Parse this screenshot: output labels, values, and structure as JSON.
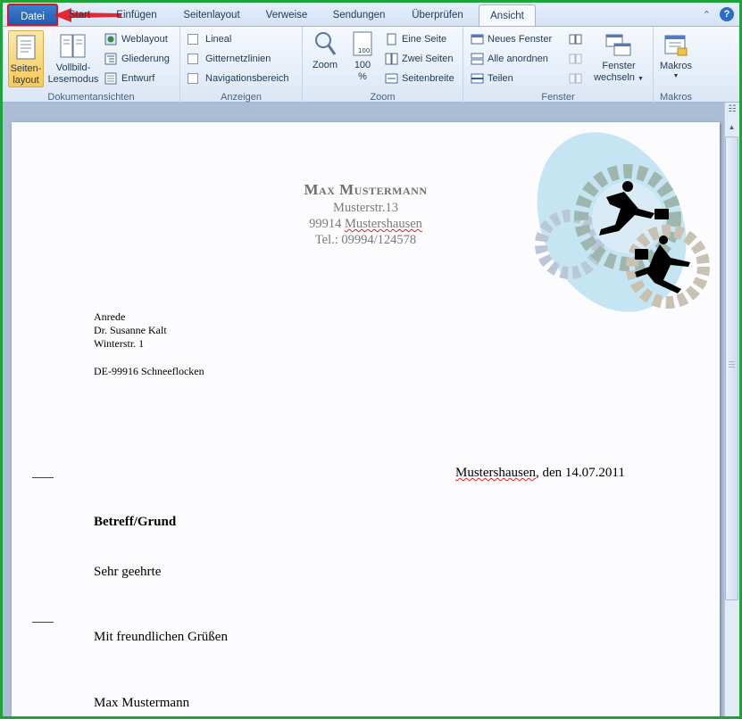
{
  "tabs": {
    "datei": "Datei",
    "start": "Start",
    "einfuegen": "Einfügen",
    "seitenlayout": "Seitenlayout",
    "verweise": "Verweise",
    "sendungen": "Sendungen",
    "ueberpruefen": "Überprüfen",
    "ansicht": "Ansicht"
  },
  "ribbon": {
    "dokumentansichten": {
      "label": "Dokumentansichten",
      "seitenlayout_1": "Seiten-",
      "seitenlayout_2": "layout",
      "vollbild_1": "Vollbild-",
      "vollbild_2": "Lesemodus",
      "weblayout": "Weblayout",
      "gliederung": "Gliederung",
      "entwurf": "Entwurf"
    },
    "anzeigen": {
      "label": "Anzeigen",
      "lineal": "Lineal",
      "gitternetzlinien": "Gitternetzlinien",
      "navigationsbereich": "Navigationsbereich"
    },
    "zoom": {
      "label": "Zoom",
      "zoom": "Zoom",
      "pct_1": "100",
      "pct_2": "%",
      "eine_seite": "Eine Seite",
      "zwei_seiten": "Zwei Seiten",
      "seitenbreite": "Seitenbreite",
      "icon_text": "100"
    },
    "fenster": {
      "label": "Fenster",
      "neues_fenster": "Neues Fenster",
      "alle_anordnen": "Alle anordnen",
      "teilen": "Teilen",
      "fenster_wechseln_1": "Fenster",
      "fenster_wechseln_2": "wechseln"
    },
    "makros": {
      "label": "Makros",
      "makros": "Makros"
    }
  },
  "letter": {
    "sender_name": "Max Mustermann",
    "sender_street": "Musterstr.13",
    "sender_city_zip": "99914",
    "sender_city": "Mustershausen",
    "sender_tel_prefix": "Tel.:",
    "sender_tel": "09994/124578",
    "recipient_salutation": "Anrede",
    "recipient_name": "Dr.  Susanne Kalt",
    "recipient_street": "Winterstr.  1",
    "recipient_city": "DE-99916 Schneeflocken",
    "date_place": "Mustershausen",
    "date_rest": ",  den 14.07.2011",
    "subject": "Betreff/Grund",
    "greeting": "Sehr geehrte",
    "closing": "Mit freundlichen Grüßen",
    "signature": "Max Mustermann"
  },
  "colors": {
    "accent_tab": "#2a6cc6",
    "callout_red": "#e0141a"
  }
}
